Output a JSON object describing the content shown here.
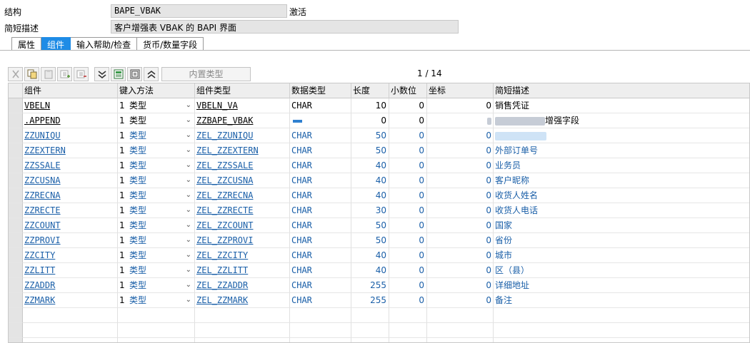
{
  "header": {
    "structure_label": "结构",
    "structure_value": "BAPE_VBAK",
    "status": "激活",
    "desc_label": "简短描述",
    "desc_value": "客户增强表 VBAK 的 BAPI 界面"
  },
  "tabs": [
    {
      "label": "属性",
      "active": false
    },
    {
      "label": "组件",
      "active": true
    },
    {
      "label": "输入帮助/检查",
      "active": false
    },
    {
      "label": "货币/数量字段",
      "active": false
    }
  ],
  "toolbar": {
    "builtin_type_label": "内置类型",
    "icons": [
      "cut-icon",
      "copy-icon",
      "paste-icon",
      "insert-row-icon",
      "delete-row-icon",
      "collapse-icon",
      "table-icon",
      "layout-icon",
      "expand-icon"
    ]
  },
  "pager": {
    "text": "1 / 14"
  },
  "table": {
    "columns": [
      "组件",
      "键入方法",
      "组件类型",
      "数据类型",
      "长度",
      "小数位",
      "坐标",
      "简短描述"
    ],
    "rows": [
      {
        "component": "VBELN",
        "method_num": "1",
        "method": "类型",
        "comp_type": "VBELN_VA",
        "data_type": "CHAR",
        "length": "10",
        "decimals": "0",
        "coord": "0",
        "desc": "销售凭证"
      },
      {
        "component": ".APPEND",
        "method_num": "1",
        "method": "类型",
        "comp_type": "ZZBAPE_VBAK",
        "data_type": "",
        "length": "0",
        "decimals": "0",
        "coord": "",
        "desc": "增强字段"
      },
      {
        "component": "ZZUNIQU",
        "method_num": "1",
        "method": "类型",
        "comp_type": "ZEL_ZZUNIQU",
        "data_type": "CHAR",
        "length": "50",
        "decimals": "0",
        "coord": "0",
        "desc": ""
      },
      {
        "component": "ZZEXTERN",
        "method_num": "1",
        "method": "类型",
        "comp_type": "ZEL_ZZEXTERN",
        "data_type": "CHAR",
        "length": "50",
        "decimals": "0",
        "coord": "0",
        "desc": "外部订单号"
      },
      {
        "component": "ZZSSALE",
        "method_num": "1",
        "method": "类型",
        "comp_type": "ZEL_ZZSSALE",
        "data_type": "CHAR",
        "length": "40",
        "decimals": "0",
        "coord": "0",
        "desc": "业务员"
      },
      {
        "component": "ZZCUSNA",
        "method_num": "1",
        "method": "类型",
        "comp_type": "ZEL_ZZCUSNA",
        "data_type": "CHAR",
        "length": "40",
        "decimals": "0",
        "coord": "0",
        "desc": "客户昵称"
      },
      {
        "component": "ZZRECNA",
        "method_num": "1",
        "method": "类型",
        "comp_type": "ZEL_ZZRECNA",
        "data_type": "CHAR",
        "length": "40",
        "decimals": "0",
        "coord": "0",
        "desc": "收货人姓名"
      },
      {
        "component": "ZZRECTE",
        "method_num": "1",
        "method": "类型",
        "comp_type": "ZEL_ZZRECTE",
        "data_type": "CHAR",
        "length": "30",
        "decimals": "0",
        "coord": "0",
        "desc": "收货人电话"
      },
      {
        "component": "ZZCOUNT",
        "method_num": "1",
        "method": "类型",
        "comp_type": "ZEL_ZZCOUNT",
        "data_type": "CHAR",
        "length": "50",
        "decimals": "0",
        "coord": "0",
        "desc": "国家"
      },
      {
        "component": "ZZPROVI",
        "method_num": "1",
        "method": "类型",
        "comp_type": "ZEL_ZZPROVI",
        "data_type": "CHAR",
        "length": "50",
        "decimals": "0",
        "coord": "0",
        "desc": "省份"
      },
      {
        "component": "ZZCITY",
        "method_num": "1",
        "method": "类型",
        "comp_type": "ZEL_ZZCITY",
        "data_type": "CHAR",
        "length": "40",
        "decimals": "0",
        "coord": "0",
        "desc": "城市"
      },
      {
        "component": "ZZLITT",
        "method_num": "1",
        "method": "类型",
        "comp_type": "ZEL_ZZLITT",
        "data_type": "CHAR",
        "length": "40",
        "decimals": "0",
        "coord": "0",
        "desc": "区（县）"
      },
      {
        "component": "ZZADDR",
        "method_num": "1",
        "method": "类型",
        "comp_type": "ZEL_ZZADDR",
        "data_type": "CHAR",
        "length": "255",
        "decimals": "0",
        "coord": "0",
        "desc": "详细地址"
      },
      {
        "component": "ZZMARK",
        "method_num": "1",
        "method": "类型",
        "comp_type": "ZEL_ZZMARK",
        "data_type": "CHAR",
        "length": "255",
        "decimals": "0",
        "coord": "0",
        "desc": "备注"
      }
    ]
  },
  "colors": {
    "active_tab": "#1f8ce6",
    "link": "#1a5fa8",
    "field_bg": "#e5e5e5",
    "header_bg": "#eeeeee"
  }
}
